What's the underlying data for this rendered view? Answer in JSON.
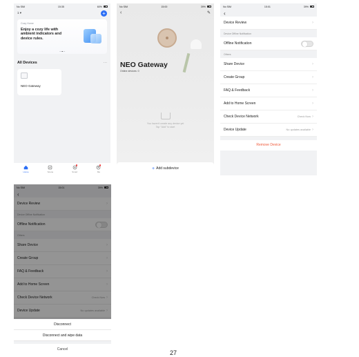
{
  "status_bar": {
    "s1": {
      "carrier": "No SIM",
      "time": "15:35",
      "battery": "60%"
    },
    "s2": {
      "carrier": "No SIM",
      "time": "15:00",
      "battery": "39%"
    },
    "s3": {
      "carrier": "No SIM",
      "time": "15:01",
      "battery": "39%"
    },
    "s4": {
      "carrier": "No SIM",
      "time": "15:01",
      "battery": "39%"
    }
  },
  "home": {
    "home_label": "1",
    "banner_tag": "Cozy Home",
    "banner_text": "Enjoy a cozy life with ambient indicators and device rules.",
    "all_devices": "All Devices",
    "more": "···",
    "device_name": "NEO Gateway",
    "tabs": [
      {
        "label": "Home",
        "icon": "home-icon"
      },
      {
        "label": "Scene",
        "icon": "scene-icon"
      },
      {
        "label": "Smart",
        "icon": "smart-icon"
      },
      {
        "label": "Me",
        "icon": "me-icon"
      }
    ]
  },
  "gateway": {
    "title": "NEO Gateway",
    "subtitle": "Online devices: 0",
    "empty_line1": "You haven't create any device yet",
    "empty_line2": "Tap \"Add\" to start",
    "add_label": "Add subdevice"
  },
  "settings": {
    "device_review": "Device Review",
    "offline_group": "Device Offline Notification",
    "offline_label": "Offline Notification",
    "others_group": "Others",
    "items": [
      "Share Device",
      "Create Group",
      "FAQ & Feedback",
      "Add to Home Screen"
    ],
    "check_network": "Check Device Network",
    "check_network_value": "Check Now",
    "device_update": "Device Update",
    "device_update_value": "No updates available",
    "remove": "Remove Device"
  },
  "sheet": {
    "disconnect": "Disconnect",
    "disconnect_wipe": "Disconnect and wipe data",
    "cancel": "Cancel"
  },
  "page_number": "27"
}
